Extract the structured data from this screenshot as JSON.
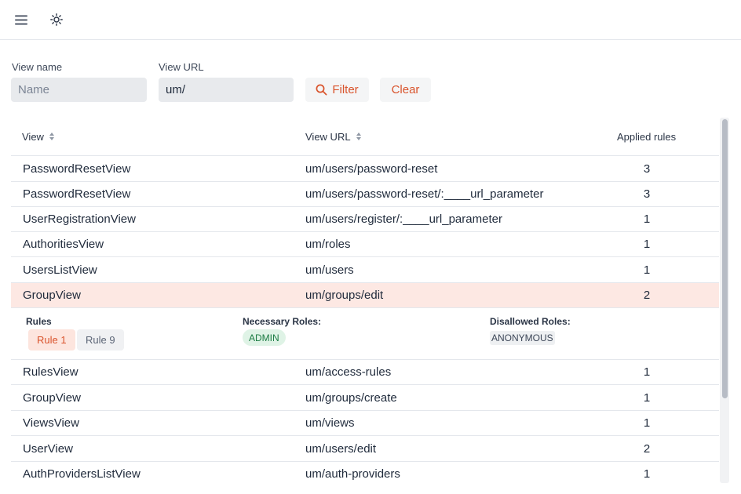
{
  "header": {
    "menu_icon": "hamburger-menu-icon",
    "theme_icon": "sun-icon"
  },
  "filters": {
    "view_name_label": "View name",
    "view_name_placeholder": "Name",
    "view_name_value": "",
    "view_url_label": "View URL",
    "view_url_value": "um/",
    "filter_label": "Filter",
    "filter_icon": "search-icon",
    "clear_label": "Clear"
  },
  "grid": {
    "headers": {
      "view": "View",
      "view_url": "View URL",
      "applied_rules": "Applied rules"
    },
    "rows_before": [
      {
        "view": "PasswordResetView",
        "url": "um/users/password-reset",
        "rules": "3"
      },
      {
        "view": "PasswordResetView",
        "url": "um/users/password-reset/:____url_parameter",
        "rules": "3"
      },
      {
        "view": "UserRegistrationView",
        "url": "um/users/register/:____url_parameter",
        "rules": "1"
      },
      {
        "view": "AuthoritiesView",
        "url": "um/roles",
        "rules": "1"
      },
      {
        "view": "UsersListView",
        "url": "um/users",
        "rules": "1"
      },
      {
        "view": "GroupView",
        "url": "um/groups/edit",
        "rules": "2"
      }
    ],
    "details": {
      "rules_title": "Rules",
      "rule_tags": [
        "Rule 1",
        "Rule 9"
      ],
      "necessary_title": "Necessary Roles:",
      "necessary_roles": [
        "ADMIN"
      ],
      "disallowed_title": "Disallowed Roles:",
      "disallowed_roles": [
        "ANONYMOUS"
      ]
    },
    "rows_after": [
      {
        "view": "RulesView",
        "url": "um/access-rules",
        "rules": "1"
      },
      {
        "view": "GroupView",
        "url": "um/groups/create",
        "rules": "1"
      },
      {
        "view": "ViewsView",
        "url": "um/views",
        "rules": "1"
      },
      {
        "view": "UserView",
        "url": "um/users/edit",
        "rules": "2"
      },
      {
        "view": "AuthProvidersListView",
        "url": "um/auth-providers",
        "rules": "1"
      }
    ]
  },
  "colors": {
    "accent": "#d9532b",
    "selected_row": "#fde8e3",
    "admin_badge_bg": "#dff3e6",
    "admin_badge_text": "#1c7c43"
  }
}
